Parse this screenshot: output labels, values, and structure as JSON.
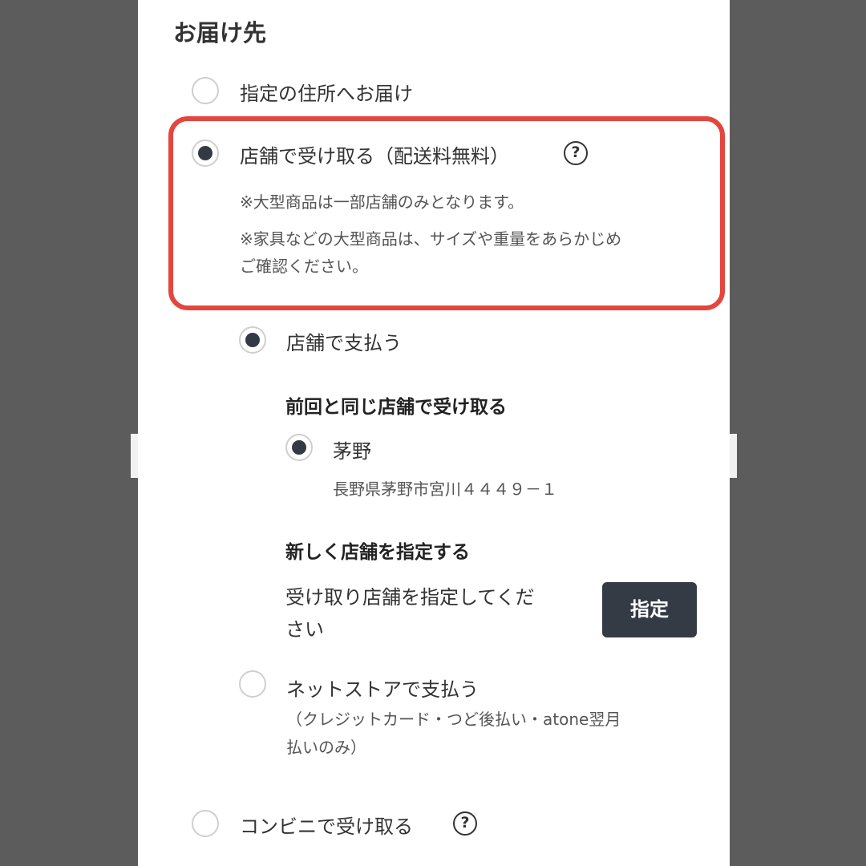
{
  "section_title": "お届け先",
  "options": {
    "address": {
      "label": "指定の住所へお届け",
      "selected": false
    },
    "store": {
      "label": "店舗で受け取る（配送料無料）",
      "selected": true,
      "help": "?",
      "notes": [
        "※大型商品は一部店舗のみとなります。",
        "※家具などの大型商品は、サイズや重量をあらかじめ",
        "ご確認ください。"
      ]
    },
    "convenience": {
      "label": "コンビニで受け取る",
      "selected": false,
      "help": "?"
    }
  },
  "payment": {
    "pay_at_store": {
      "label": "店舗で支払う",
      "selected": true
    },
    "net_store": {
      "label": "ネットストアで支払う",
      "note_line1": "（クレジットカード・つど後払い・atone翌月",
      "note_line2": "払いのみ）",
      "selected": false
    }
  },
  "previous_store": {
    "heading": "前回と同じ店舗で受け取る",
    "name": "茅野",
    "address": "長野県茅野市宮川４４４９－１",
    "selected": true
  },
  "new_store": {
    "heading": "新しく店舗を指定する",
    "prompt_line1": "受け取り店舗を指定してくだ",
    "prompt_line2": "さい",
    "button_label": "指定"
  },
  "colors": {
    "highlight": "#e4463d",
    "button_bg": "#353b45",
    "radio_dot": "#333a44",
    "backdrop": "#5c5c5c"
  }
}
